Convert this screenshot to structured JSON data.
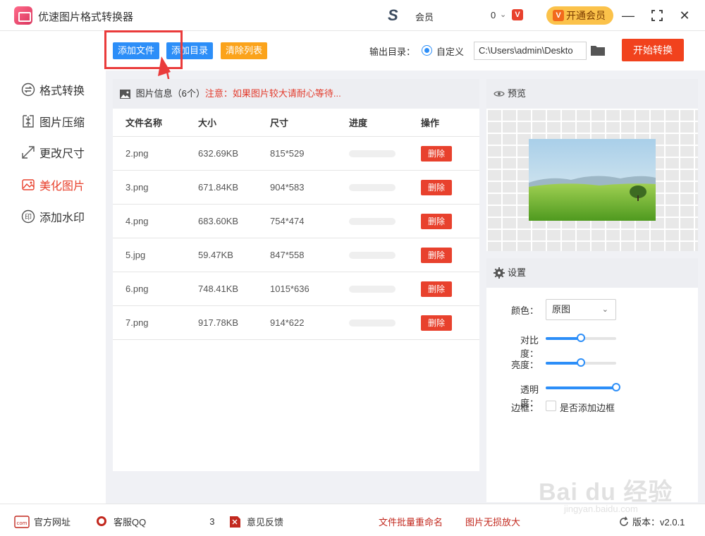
{
  "app": {
    "title": "优速图片格式转换器",
    "member_label": "会员",
    "count": "0",
    "badge": "V",
    "vip_button": "开通会员",
    "vip_icon": "V"
  },
  "toolbar": {
    "add_file": "添加文件",
    "add_dir": "添加目录",
    "clear_list": "清除列表",
    "output_label": "输出目录：",
    "custom_label": "自定义",
    "output_path": "C:\\Users\\admin\\Deskto",
    "start_button": "开始转换"
  },
  "sidebar": {
    "items": [
      {
        "label": "格式转换",
        "icon": "format-convert-icon"
      },
      {
        "label": "图片压缩",
        "icon": "compress-icon"
      },
      {
        "label": "更改尺寸",
        "icon": "resize-icon"
      },
      {
        "label": "美化图片",
        "icon": "beautify-icon",
        "active": true
      },
      {
        "label": "添加水印",
        "icon": "watermark-icon"
      }
    ]
  },
  "file_panel": {
    "info_title": "图片信息（6个）",
    "warning": "注意：如果图片较大请耐心等待...",
    "columns": [
      "文件名称",
      "大小",
      "尺寸",
      "进度",
      "操作"
    ],
    "rows": [
      {
        "name": "2.png",
        "size": "632.69KB",
        "dims": "815*529",
        "progress": 0,
        "action": "删除"
      },
      {
        "name": "3.png",
        "size": "671.84KB",
        "dims": "904*583",
        "progress": 0,
        "action": "删除"
      },
      {
        "name": "4.png",
        "size": "683.60KB",
        "dims": "754*474",
        "progress": 0,
        "action": "删除"
      },
      {
        "name": "5.jpg",
        "size": "59.47KB",
        "dims": "847*558",
        "progress": 0,
        "action": "删除"
      },
      {
        "name": "6.png",
        "size": "748.41KB",
        "dims": "1015*636",
        "progress": 0,
        "action": "删除"
      },
      {
        "name": "7.png",
        "size": "917.78KB",
        "dims": "914*622",
        "progress": 0,
        "action": "删除"
      }
    ]
  },
  "preview": {
    "title": "预览"
  },
  "settings": {
    "title": "设置",
    "color_label": "颜色：",
    "color_value": "原图",
    "contrast_label": "对比度：",
    "contrast_value": 0.5,
    "brightness_label": "亮度：",
    "brightness_value": 0.5,
    "opacity_label": "透明度：",
    "opacity_value": 1.0,
    "border_label": "边框：",
    "border_checkbox": "是否添加边框"
  },
  "bottom": {
    "official_site": "官方网址",
    "service": "客服QQ",
    "service_tail": "3",
    "feedback": "意见反馈",
    "batch_rename": "文件批量重命名",
    "lossless_enlarge": "图片无损放大",
    "version": "版本：v2.0.1"
  },
  "watermark": {
    "text": "Bai du 经验",
    "url": "jingyan.baidu.com"
  },
  "colors": {
    "accent": "#2c8ef8",
    "danger": "#e8412d",
    "warning": "#fba31b",
    "vip": "#fbc24a"
  }
}
